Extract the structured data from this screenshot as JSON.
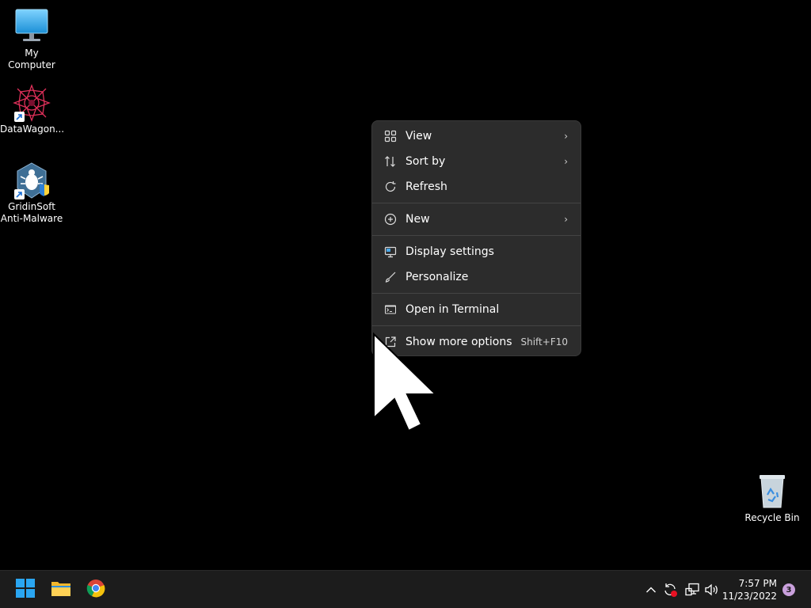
{
  "desktop": {
    "icons": [
      {
        "label": "My Computer"
      },
      {
        "label": "DataWagon..."
      },
      {
        "label_line1": "GridinSoft",
        "label_line2": "Anti-Malware"
      },
      {
        "label": "Recycle Bin"
      }
    ]
  },
  "context_menu": {
    "items": [
      {
        "label": "View",
        "icon": "grid-icon",
        "has_submenu": true
      },
      {
        "label": "Sort by",
        "icon": "sort-icon",
        "has_submenu": true
      },
      {
        "label": "Refresh",
        "icon": "refresh-icon"
      },
      {
        "label": "New",
        "icon": "plus-circle-icon",
        "has_submenu": true
      },
      {
        "label": "Display settings",
        "icon": "display-icon"
      },
      {
        "label": "Personalize",
        "icon": "brush-icon"
      },
      {
        "label": "Open in Terminal",
        "icon": "terminal-icon"
      },
      {
        "label": "Show more options",
        "icon": "external-icon",
        "shortcut": "Shift+F10"
      }
    ],
    "chevron": "›"
  },
  "taskbar": {
    "clock_time": "7:57 PM",
    "clock_date": "11/23/2022",
    "notification_count": "3",
    "tray_overflow": "^"
  }
}
